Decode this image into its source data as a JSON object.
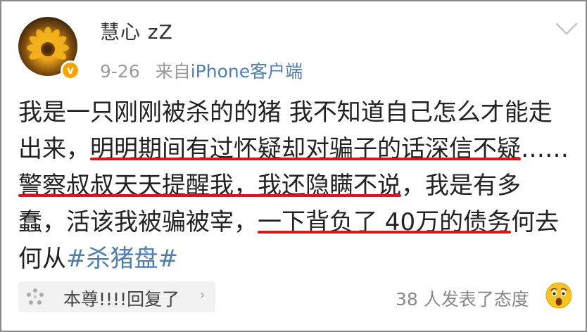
{
  "post": {
    "username": "慧心 zZ",
    "date": "9-26",
    "source_prefix": "来自",
    "source": "iPhone客户端",
    "lines": [
      [
        "我是一只刚刚被杀的的猪 我不知道自己怎么才能走"
      ],
      [
        "出来，",
        "明明期间有过怀疑却对骗子的话深信不疑",
        "……"
      ],
      [
        "警察叔叔天天提醒我，我还隐瞒不说",
        "，我是有多"
      ],
      [
        "蠢，活该我被骗被宰，",
        "一下背负了 40万的债务",
        "何去"
      ],
      [
        "何从",
        "#杀猪盘#"
      ]
    ]
  },
  "reply": {
    "text": "本尊!!!!回复了",
    "arrow": "›"
  },
  "reactions_text": "38 人发表了态度",
  "icons": {
    "verified": "v-badge-icon",
    "chevron": "chevron-down-icon",
    "comment": "comment-dots-icon",
    "emoji": "surprised-face-icon"
  },
  "colors": {
    "link": "#507daf",
    "underline": "#d8161c",
    "badge": "#f6a400"
  }
}
